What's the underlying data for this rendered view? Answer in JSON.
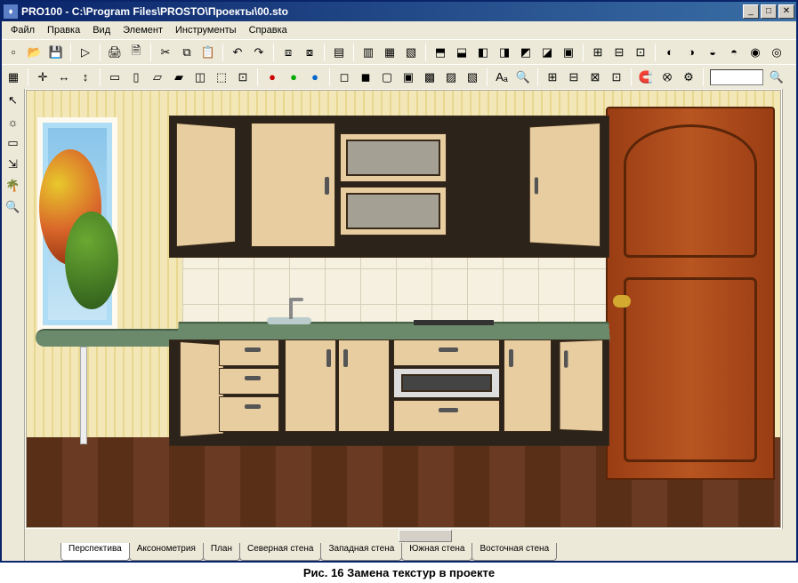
{
  "window": {
    "title": "PRO100 - C:\\Program Files\\PROSTO\\Проекты\\00.sto"
  },
  "menu": [
    "Файл",
    "Правка",
    "Вид",
    "Элемент",
    "Инструменты",
    "Справка"
  ],
  "toolbar1_icons": [
    "new",
    "open",
    "save",
    "sep",
    "wizard",
    "sep",
    "print",
    "print-pv",
    "sep",
    "cut",
    "copy",
    "paste",
    "sep",
    "undo",
    "redo",
    "sep",
    "cube1",
    "cube2",
    "sep",
    "layers",
    "sep",
    "layer-a",
    "layer-b",
    "layer-c",
    "sep",
    "col1",
    "col2",
    "col3",
    "col4",
    "col5",
    "col6",
    "col7",
    "sep",
    "grp1",
    "grp2",
    "grp3",
    "sep",
    "tx1",
    "tx2",
    "tx3",
    "tx4",
    "tx5",
    "tx6"
  ],
  "toolbar2_icons": [
    "grid",
    "sep",
    "snap1",
    "snap2",
    "snap3",
    "sep",
    "view1",
    "view2",
    "view3",
    "view4",
    "view5",
    "view6",
    "view7",
    "sep",
    "red",
    "green",
    "blue",
    "sep",
    "shade1",
    "shade2",
    "shade3",
    "shade4",
    "shade5",
    "shade6",
    "shade7",
    "sep",
    "text",
    "find",
    "sep",
    "proj1",
    "proj2",
    "proj3",
    "proj4",
    "sep",
    "mag1",
    "mag2",
    "mag3",
    "sep",
    "combo",
    "zoom"
  ],
  "side_icons": [
    "cursor",
    "light",
    "rect",
    "snap",
    "tree",
    "zoom"
  ],
  "tabs": [
    "Перспектива",
    "Аксонометрия",
    "План",
    "Северная стена",
    "Западная стена",
    "Южная стена",
    "Восточная стена"
  ],
  "caption": "Рис. 16  Замена текстур  в проекте"
}
